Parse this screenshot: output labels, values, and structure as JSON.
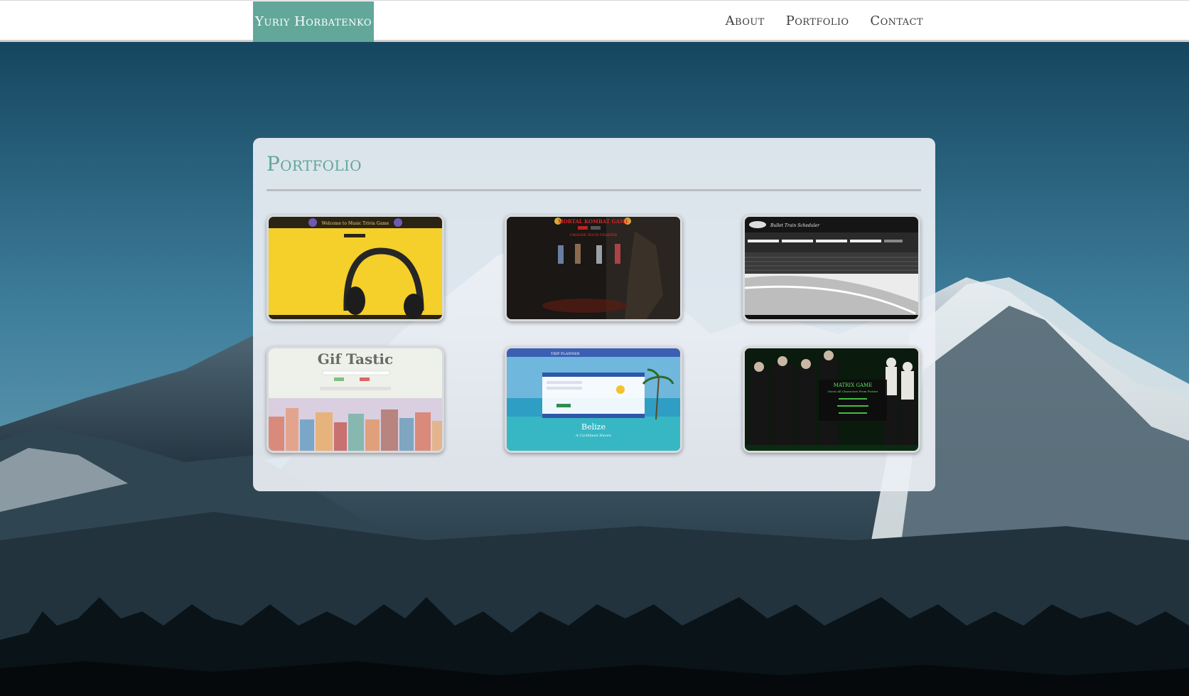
{
  "navbar": {
    "brand": "Yuriy Horbatenko",
    "links": [
      "About",
      "Portfolio",
      "Contact"
    ]
  },
  "portfolio": {
    "title": "Portfolio",
    "projects": [
      {
        "title": "Welcome to Music Trivia Game"
      },
      {
        "title": "MORTAL KOMBAT GAME",
        "subtitle": "CHOOSE YOUR FIGHTER"
      },
      {
        "title": "Bullet Train Scheduler"
      },
      {
        "title": "Gif Tastic"
      },
      {
        "title": "Belize",
        "subtitle": "A Caribbean Haven",
        "header": "TRIP PLANNER"
      },
      {
        "title": "MATRIX GAME",
        "subtitle": "Guess All Characters From Picture"
      }
    ]
  },
  "colors": {
    "accent": "#62a79a",
    "nav_text": "#3d3d3d",
    "sky_top": "#0d3d55",
    "sky_bottom": "#4d88a3"
  }
}
